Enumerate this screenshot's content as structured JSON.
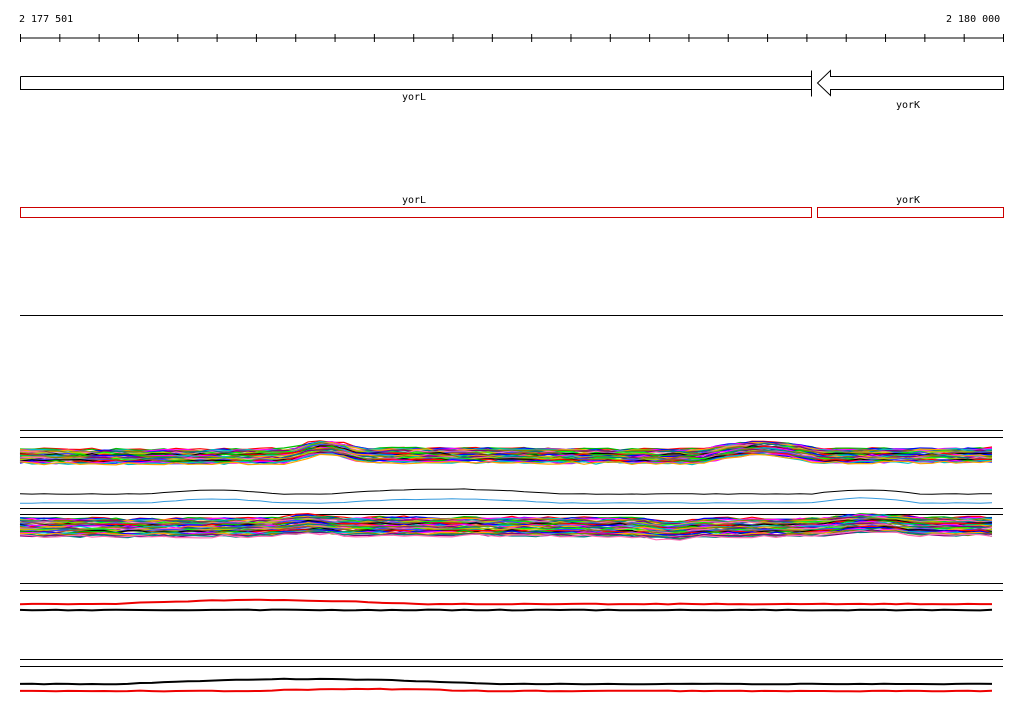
{
  "ruler": {
    "start_label": "2 177 501",
    "end_label": "2 180 000"
  },
  "genes_top": [
    {
      "name": "yorL",
      "strand": "+",
      "outline": "#000000"
    },
    {
      "name": "yorK",
      "strand": "-",
      "outline": "#000000"
    }
  ],
  "genes_red": [
    {
      "name": "yorL",
      "outline": "#cc0000"
    },
    {
      "name": "yorK",
      "outline": "#cc0000"
    }
  ],
  "colors": {
    "gene_outline": "#000000",
    "annotation_outline": "#cc0000",
    "separator": "#000000",
    "profile_palette": [
      "#ff0000",
      "#00c000",
      "#0000ff",
      "#ff00ff",
      "#00c0c0",
      "#ffa500",
      "#808000",
      "#800080",
      "#008080",
      "#ff69b4",
      "#00ff00",
      "#c0c000",
      "#4040ff",
      "#a0522d",
      "#000000"
    ]
  }
}
